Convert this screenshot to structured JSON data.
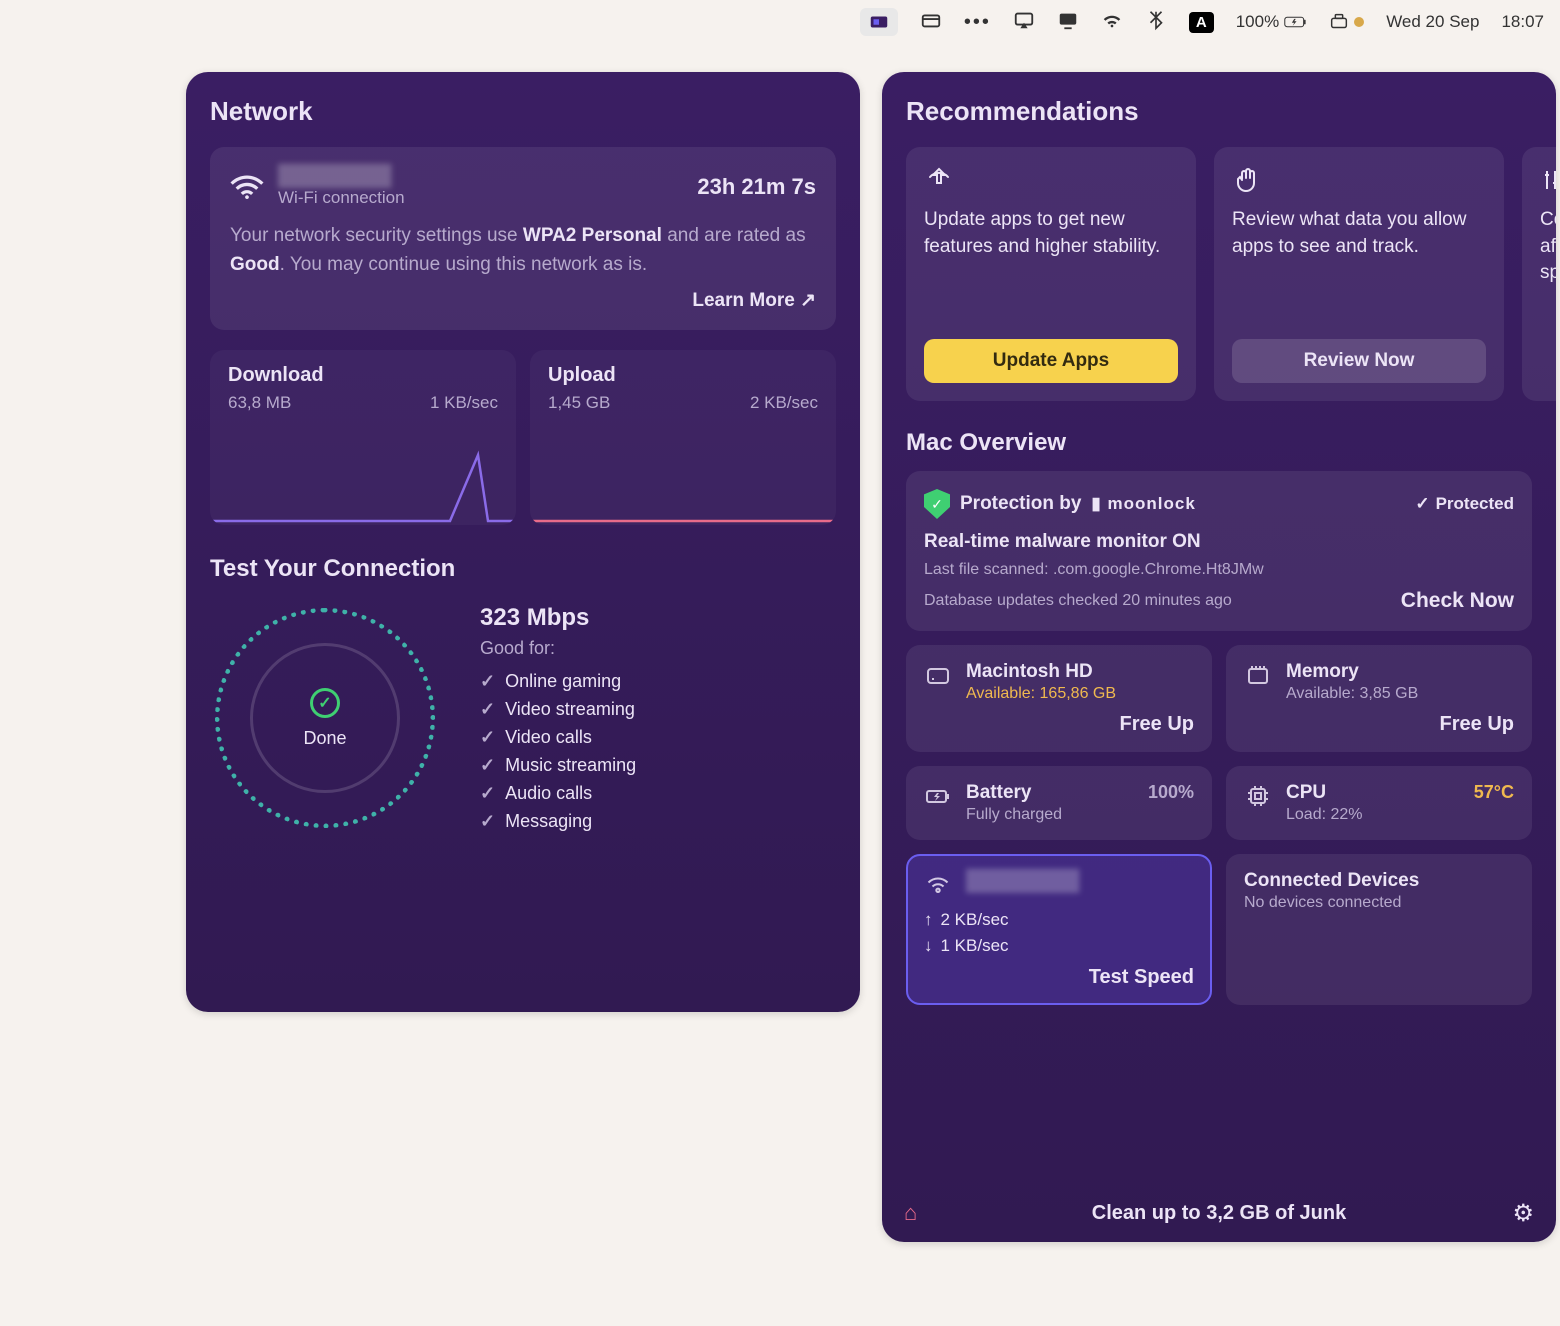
{
  "menubar": {
    "battery_pct": "100%",
    "date": "Wed 20 Sep",
    "time": "18:07",
    "a_label": "A"
  },
  "network_panel": {
    "title": "Network",
    "ssid_blur": "████████",
    "sub": "Wi-Fi connection",
    "uptime": "23h 21m 7s",
    "desc_pre": "Your network security settings use ",
    "desc_sec": "WPA2 Personal",
    "desc_mid": " and are rated as ",
    "desc_good": "Good",
    "desc_post": ". You may continue using this network as is.",
    "learn_more": "Learn More ↗",
    "download": {
      "title": "Download",
      "total": "63,8 MB",
      "rate": "1 KB/sec"
    },
    "upload": {
      "title": "Upload",
      "total": "1,45 GB",
      "rate": "2 KB/sec"
    },
    "test": {
      "title": "Test Your Connection",
      "done": "Done",
      "speed": "323 Mbps",
      "good_for": "Good for:",
      "items": [
        "Online gaming",
        "Video streaming",
        "Video calls",
        "Music streaming",
        "Audio calls",
        "Messaging"
      ]
    }
  },
  "right_panel": {
    "rec_title": "Recommendations",
    "rec1_text": "Update apps to get new features and higher stability.",
    "rec1_btn": "Update Apps",
    "rec2_text": "Review what data you allow apps to see and track.",
    "rec2_btn": "Review Now",
    "rec3_text": "Con\naffe\nspe",
    "overview_title": "Mac Overview",
    "protection": {
      "by": "Protection by",
      "brand": "▮ moonlock",
      "status": "Protected",
      "realtime": "Real-time malware monitor ON",
      "last_scan": "Last file scanned: .com.google.Chrome.Ht8JMw",
      "db": "Database updates checked 20 minutes ago",
      "check": "Check Now"
    },
    "disk": {
      "title": "Macintosh HD",
      "sub": "Available: 165,86 GB",
      "action": "Free Up"
    },
    "memory": {
      "title": "Memory",
      "sub": "Available: 3,85 GB",
      "action": "Free Up"
    },
    "battery": {
      "title": "Battery",
      "sub": "Fully charged",
      "val": "100%"
    },
    "cpu": {
      "title": "CPU",
      "sub": "Load: 22%",
      "val": "57°C"
    },
    "net": {
      "ssid": "████████",
      "up": "2 KB/sec",
      "down": "1 KB/sec",
      "action": "Test Speed"
    },
    "devices": {
      "title": "Connected Devices",
      "sub": "No devices connected"
    },
    "bottom": "Clean up to 3,2 GB of Junk"
  }
}
